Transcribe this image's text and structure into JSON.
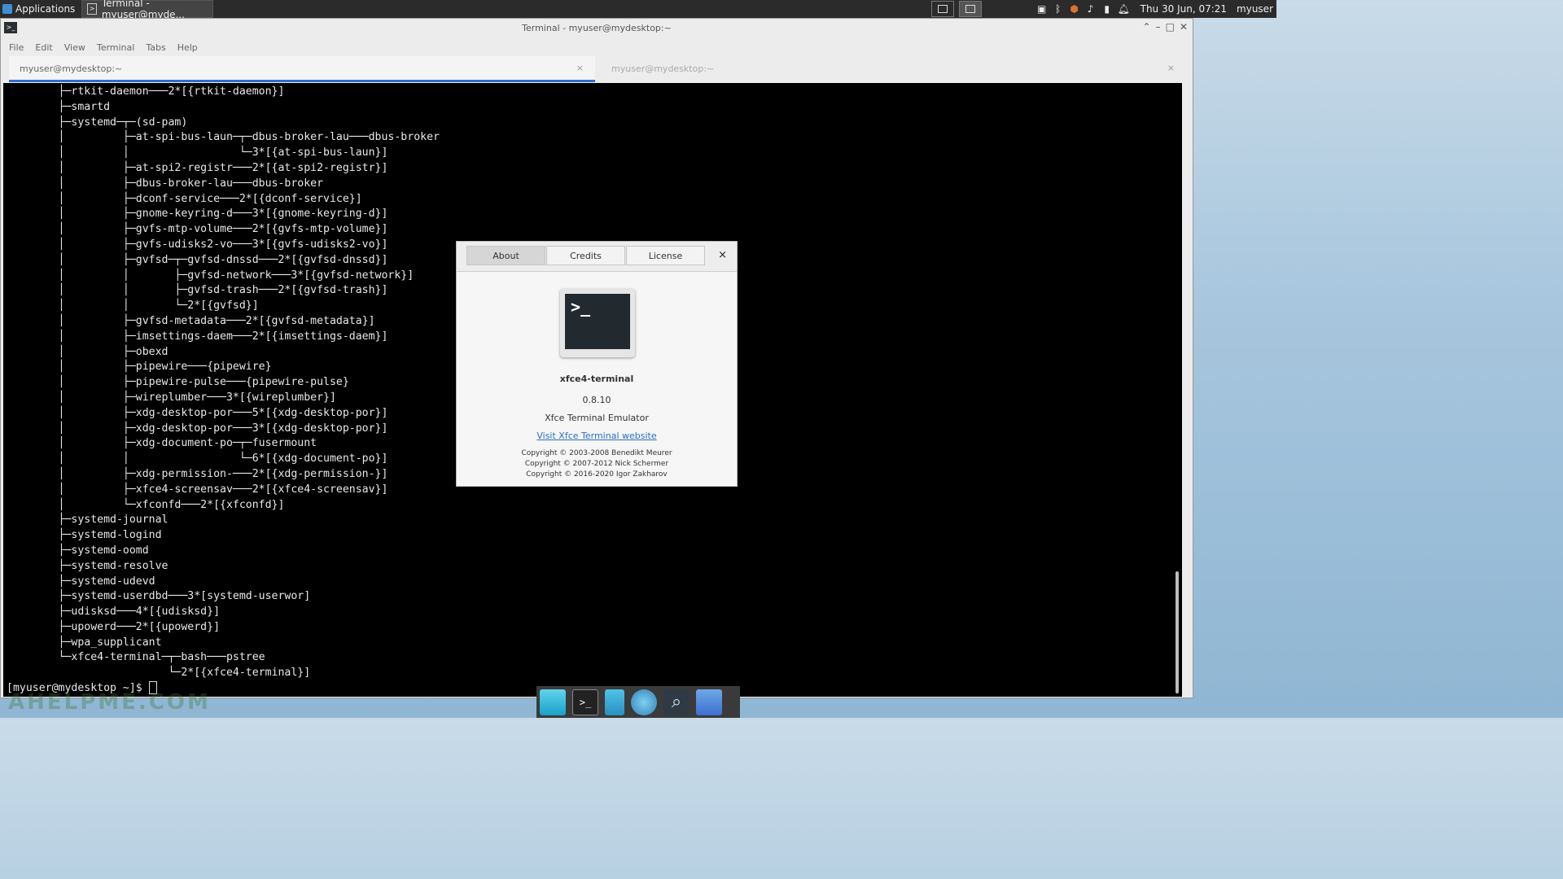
{
  "panel": {
    "applications_label": "Applications",
    "task_label": "Terminal - myuser@myde...",
    "datetime": "Thu 30 Jun, 07:21",
    "user": "myuser"
  },
  "window": {
    "title": "Terminal - myuser@mydesktop:~",
    "menu": [
      "File",
      "Edit",
      "View",
      "Terminal",
      "Tabs",
      "Help"
    ],
    "tabs": [
      {
        "label": "myuser@mydesktop:~",
        "close": "×"
      },
      {
        "label": "myuser@mydesktop:~",
        "close": "×"
      }
    ]
  },
  "terminal": {
    "text": "        ├─rtkit-daemon───2*[{rtkit-daemon}]\n        ├─smartd\n        ├─systemd─┬─(sd-pam)\n        │         ├─at-spi-bus-laun─┬─dbus-broker-lau───dbus-broker\n        │         │                 └─3*[{at-spi-bus-laun}]\n        │         ├─at-spi2-registr───2*[{at-spi2-registr}]\n        │         ├─dbus-broker-lau───dbus-broker\n        │         ├─dconf-service───2*[{dconf-service}]\n        │         ├─gnome-keyring-d───3*[{gnome-keyring-d}]\n        │         ├─gvfs-mtp-volume───2*[{gvfs-mtp-volume}]\n        │         ├─gvfs-udisks2-vo───3*[{gvfs-udisks2-vo}]\n        │         ├─gvfsd─┬─gvfsd-dnssd───2*[{gvfsd-dnssd}]\n        │         │       ├─gvfsd-network───3*[{gvfsd-network}]\n        │         │       ├─gvfsd-trash───2*[{gvfsd-trash}]\n        │         │       └─2*[{gvfsd}]\n        │         ├─gvfsd-metadata───2*[{gvfsd-metadata}]\n        │         ├─imsettings-daem───2*[{imsettings-daem}]\n        │         ├─obexd\n        │         ├─pipewire───{pipewire}\n        │         ├─pipewire-pulse───{pipewire-pulse}\n        │         ├─wireplumber───3*[{wireplumber}]\n        │         ├─xdg-desktop-por───5*[{xdg-desktop-por}]\n        │         ├─xdg-desktop-por───3*[{xdg-desktop-por}]\n        │         ├─xdg-document-po─┬─fusermount\n        │         │                 └─6*[{xdg-document-po}]\n        │         ├─xdg-permission-───2*[{xdg-permission-}]\n        │         ├─xfce4-screensav───2*[{xfce4-screensav}]\n        │         └─xfconfd───2*[{xfconfd}]\n        ├─systemd-journal\n        ├─systemd-logind\n        ├─systemd-oomd\n        ├─systemd-resolve\n        ├─systemd-udevd\n        ├─systemd-userdbd───3*[systemd-userwor]\n        ├─udisksd───4*[{udisksd}]\n        ├─upowerd───2*[{upowerd}]\n        ├─wpa_supplicant\n        └─xfce4-terminal─┬─bash───pstree\n                         └─2*[{xfce4-terminal}]",
    "prompt": "[myuser@mydesktop ~]$ "
  },
  "watermark": "AHELPME.COM",
  "dialog": {
    "tabs": [
      "About",
      "Credits",
      "License"
    ],
    "close": "×",
    "app_name": "xfce4-terminal",
    "version": "0.8.10",
    "description": "Xfce Terminal Emulator",
    "link": "Visit Xfce Terminal website",
    "copyright": [
      "Copyright © 2003-2008 Benedikt Meurer",
      "Copyright © 2007-2012 Nick Schermer",
      "Copyright © 2016-2020 Igor Zakharov"
    ]
  },
  "icons": {
    "dock": [
      "desktop-icon",
      "terminal-icon",
      "file-manager-icon",
      "web-browser-icon",
      "search-icon",
      "folder-icon"
    ]
  },
  "colors": {
    "tab_accent": "#2f6fd0",
    "link": "#2a6fc9",
    "terminal_bg": "#000000"
  }
}
